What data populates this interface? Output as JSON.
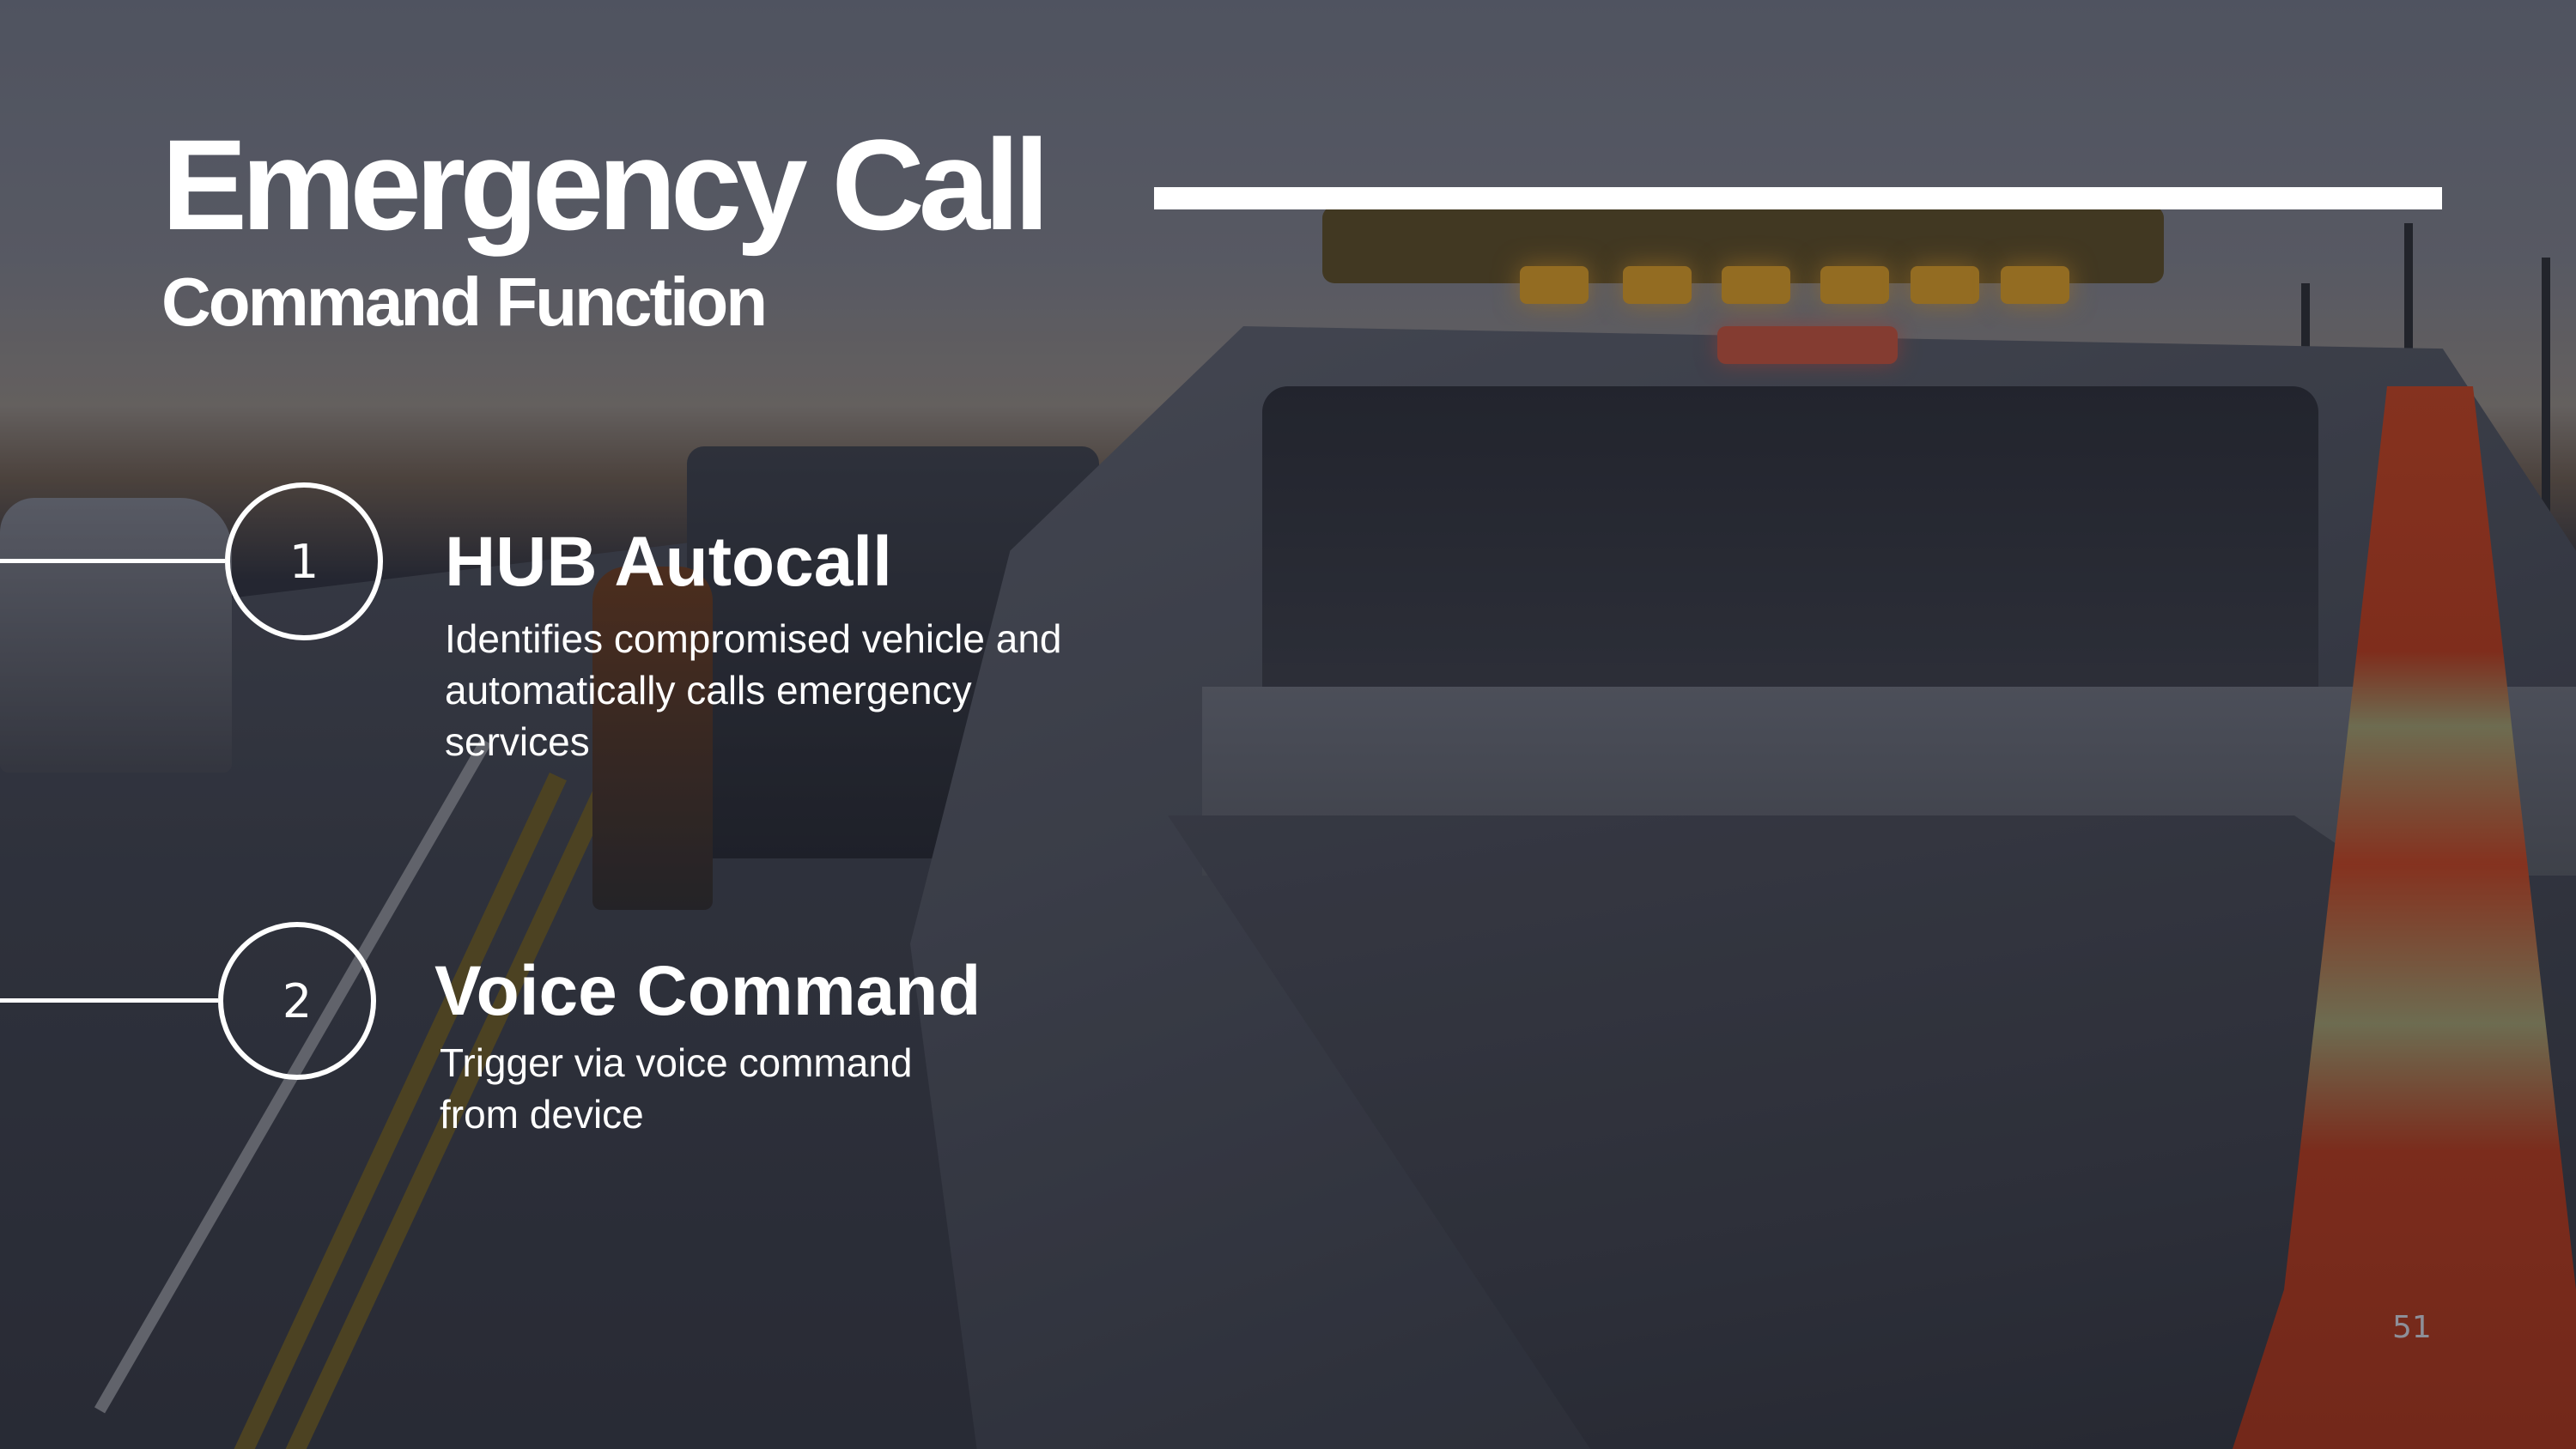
{
  "slide": {
    "title": "Emergency Call",
    "subtitle": "Command Function",
    "page_number": "51",
    "background_icon": "roadside-tow-truck-photo"
  },
  "items": [
    {
      "number": "1",
      "title": "HUB Autocall",
      "description": "Identifies compromised vehicle and automatically calls emergency services"
    },
    {
      "number": "2",
      "title": "Voice Command",
      "description": "Trigger via voice command from device"
    }
  ],
  "colors": {
    "text": "#ffffff",
    "accent_line": "#ffffff",
    "page_number": "#8d8f99"
  }
}
